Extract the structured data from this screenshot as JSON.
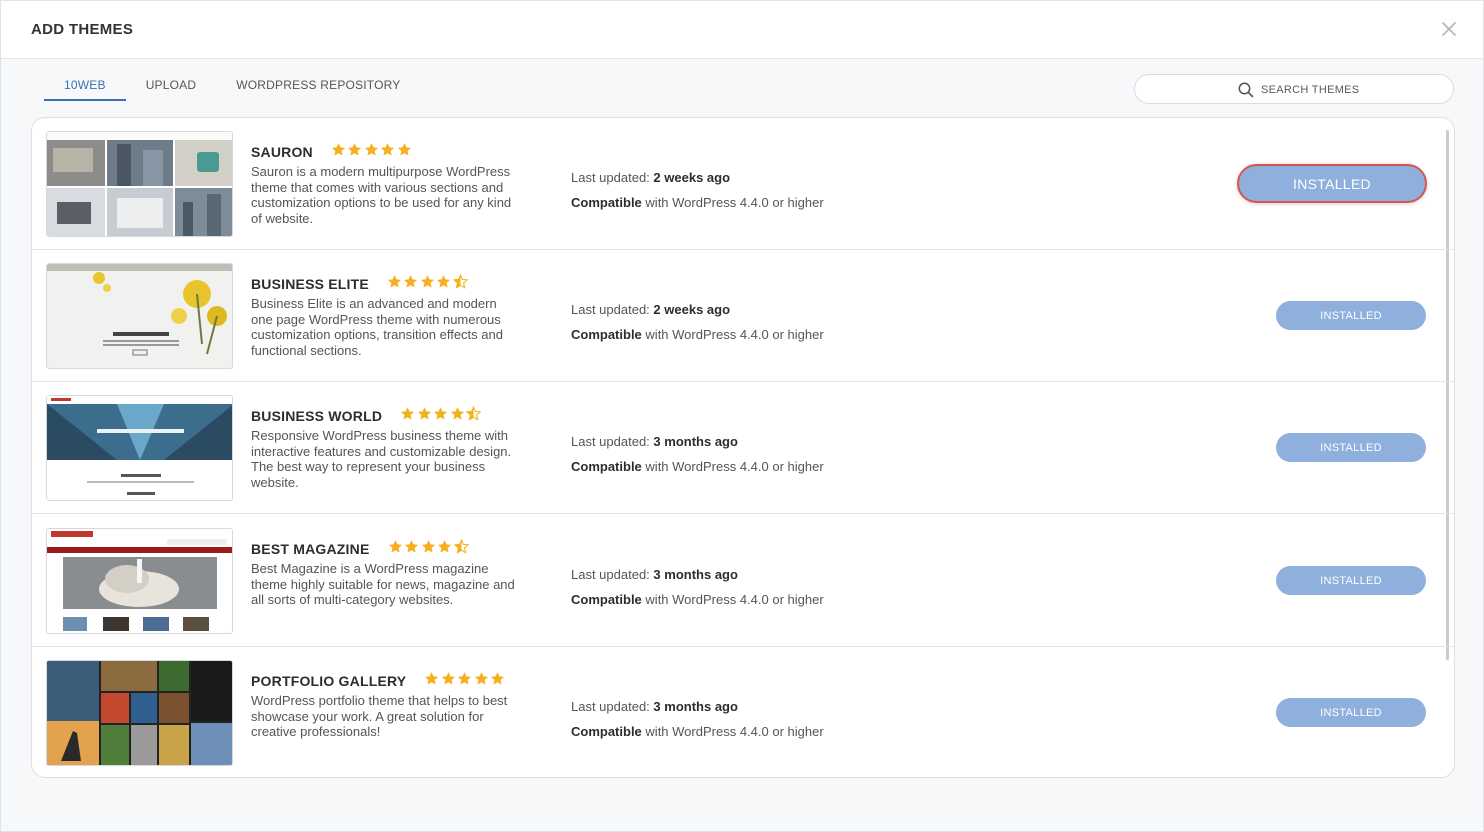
{
  "modal": {
    "title": "ADD THEMES"
  },
  "tabs": [
    {
      "label": "10WEB"
    },
    {
      "label": "UPLOAD"
    },
    {
      "label": "WORDPRESS REPOSITORY"
    }
  ],
  "search": {
    "placeholder": "SEARCH THEMES"
  },
  "colors": {
    "accent": "#3a6fb0",
    "button": "#8fb0dd",
    "star": "#f6b01e",
    "focus_border": "#d9534f"
  },
  "themes": [
    {
      "name": "SAURON",
      "rating": 5,
      "description": "Sauron is a modern multipurpose WordPress theme that comes with various sections and customization options to be used for any kind of website.",
      "updated_label": "Last updated:",
      "updated_value": "2 weeks ago",
      "compat_label": "Compatible",
      "compat_value": "with WordPress 4.4.0 or higher",
      "button": "INSTALLED"
    },
    {
      "name": "BUSINESS ELITE",
      "rating": 4.5,
      "description": "Business Elite is an advanced and modern one page WordPress theme with numerous customization options, transition effects and functional sections.",
      "updated_label": "Last updated:",
      "updated_value": "2 weeks ago",
      "compat_label": "Compatible",
      "compat_value": "with WordPress 4.4.0 or higher",
      "button": "INSTALLED"
    },
    {
      "name": "BUSINESS WORLD",
      "rating": 4.5,
      "description": "Responsive WordPress business theme with interactive features and customizable design. The best way to represent your business website.",
      "updated_label": "Last updated:",
      "updated_value": "3 months ago",
      "compat_label": "Compatible",
      "compat_value": "with WordPress 4.4.0 or higher",
      "button": "INSTALLED"
    },
    {
      "name": "BEST MAGAZINE",
      "rating": 4.5,
      "description": "Best Magazine is a WordPress magazine theme highly suitable for news, magazine and all sorts of multi-category websites.",
      "updated_label": "Last updated:",
      "updated_value": "3 months ago",
      "compat_label": "Compatible",
      "compat_value": "with WordPress 4.4.0 or higher",
      "button": "INSTALLED"
    },
    {
      "name": "PORTFOLIO GALLERY",
      "rating": 5,
      "description": "WordPress portfolio theme that helps to best showcase your work. A great solution for creative professionals!",
      "updated_label": "Last updated:",
      "updated_value": "3 months ago",
      "compat_label": "Compatible",
      "compat_value": "with WordPress 4.4.0 or higher",
      "button": "INSTALLED"
    }
  ]
}
